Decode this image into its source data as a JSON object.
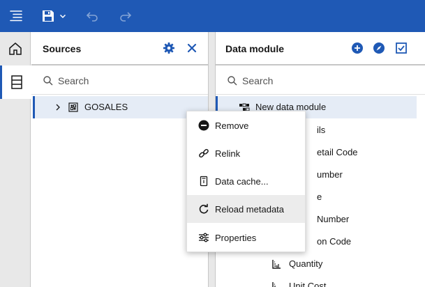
{
  "topbar": {
    "menu_icon": "menu-lines-icon",
    "save_icon": "save-icon",
    "save_dropdown_icon": "chevron-down-icon",
    "undo_icon": "undo-icon",
    "redo_icon": "redo-icon"
  },
  "rail": {
    "items": [
      {
        "icon": "home-icon",
        "active": false
      },
      {
        "icon": "list-icon",
        "active": true
      }
    ]
  },
  "sources": {
    "title": "Sources",
    "settings_icon": "gear-icon",
    "close_icon": "close-icon",
    "search_placeholder": "Search",
    "tree": [
      {
        "label": "GOSALES",
        "icon": "database-icon",
        "expanded": false,
        "selected": true
      }
    ]
  },
  "module": {
    "title": "Data module",
    "add_icon": "add-circle-icon",
    "explore_icon": "compass-icon",
    "validate_icon": "checkbox-check-icon",
    "search_placeholder": "Search",
    "root": {
      "label": "New data module",
      "icon": "data-module-icon"
    },
    "items_partial": [
      "ils",
      "etail Code",
      "umber",
      "e",
      "Number",
      "on Code"
    ],
    "items_full": [
      {
        "label": "Quantity",
        "icon": "measure-icon"
      },
      {
        "label": "Unit Cost",
        "icon": "measure-icon"
      }
    ]
  },
  "context_menu": {
    "items": [
      {
        "label": "Remove",
        "icon": "remove-circle-icon"
      },
      {
        "label": "Relink",
        "icon": "link-icon"
      },
      {
        "label": "Data cache...",
        "icon": "cache-icon"
      },
      {
        "label": "Reload metadata",
        "icon": "reload-icon",
        "hovered": true
      },
      {
        "label": "Properties",
        "icon": "sliders-icon"
      }
    ]
  },
  "colors": {
    "topbar": "#1f59b5",
    "accent": "#1f59b5",
    "selected_row": "#e5ecf6",
    "rail": "#e8e8e8"
  }
}
